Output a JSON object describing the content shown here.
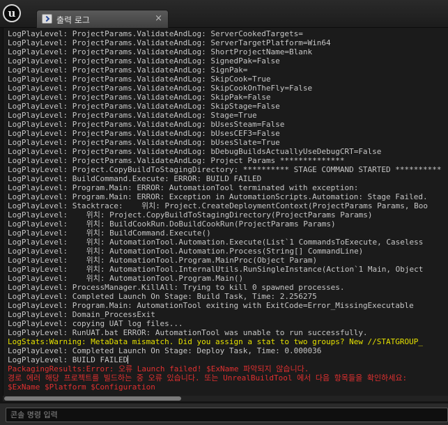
{
  "window": {
    "logo_glyph": "u",
    "tab": {
      "label": "출력 로그",
      "close": "×"
    }
  },
  "log": {
    "lines": [
      {
        "text": "LogPlayLevel: ProjectParams.ValidateAndLog: ServerCookedTargets=",
        "level": "info"
      },
      {
        "text": "LogPlayLevel: ProjectParams.ValidateAndLog: ServerTargetPlatform=Win64",
        "level": "info"
      },
      {
        "text": "LogPlayLevel: ProjectParams.ValidateAndLog: ShortProjectName=Blank",
        "level": "info"
      },
      {
        "text": "LogPlayLevel: ProjectParams.ValidateAndLog: SignedPak=False",
        "level": "info"
      },
      {
        "text": "LogPlayLevel: ProjectParams.ValidateAndLog: SignPak=",
        "level": "info"
      },
      {
        "text": "LogPlayLevel: ProjectParams.ValidateAndLog: SkipCook=True",
        "level": "info"
      },
      {
        "text": "LogPlayLevel: ProjectParams.ValidateAndLog: SkipCookOnTheFly=False",
        "level": "info"
      },
      {
        "text": "LogPlayLevel: ProjectParams.ValidateAndLog: SkipPak=False",
        "level": "info"
      },
      {
        "text": "LogPlayLevel: ProjectParams.ValidateAndLog: SkipStage=False",
        "level": "info"
      },
      {
        "text": "LogPlayLevel: ProjectParams.ValidateAndLog: Stage=True",
        "level": "info"
      },
      {
        "text": "LogPlayLevel: ProjectParams.ValidateAndLog: bUsesSteam=False",
        "level": "info"
      },
      {
        "text": "LogPlayLevel: ProjectParams.ValidateAndLog: bUsesCEF3=False",
        "level": "info"
      },
      {
        "text": "LogPlayLevel: ProjectParams.ValidateAndLog: bUsesSlate=True",
        "level": "info"
      },
      {
        "text": "LogPlayLevel: ProjectParams.ValidateAndLog: bDebugBuildsActuallyUseDebugCRT=False",
        "level": "info"
      },
      {
        "text": "LogPlayLevel: ProjectParams.ValidateAndLog: Project Params **************",
        "level": "info"
      },
      {
        "text": "LogPlayLevel: Project.CopyBuildToStagingDirectory: ********** STAGE COMMAND STARTED **********",
        "level": "info"
      },
      {
        "text": "LogPlayLevel: BuildCommand.Execute: ERROR: BUILD FAILED",
        "level": "info"
      },
      {
        "text": "LogPlayLevel: Program.Main: ERROR: AutomationTool terminated with exception:",
        "level": "info"
      },
      {
        "text": "LogPlayLevel: Program.Main: ERROR: Exception in AutomationScripts.Automation: Stage Failed.",
        "level": "info"
      },
      {
        "text": "LogPlayLevel: Stacktrace:    위치: Project.CreateDeploymentContext(ProjectParams Params, Boo",
        "level": "info"
      },
      {
        "text": "LogPlayLevel:    위치: Project.CopyBuildToStagingDirectory(ProjectParams Params)",
        "level": "info"
      },
      {
        "text": "LogPlayLevel:    위치: BuildCookRun.DoBuildCookRun(ProjectParams Params)",
        "level": "info"
      },
      {
        "text": "LogPlayLevel:    위치: BuildCommand.Execute()",
        "level": "info"
      },
      {
        "text": "LogPlayLevel:    위치: AutomationTool.Automation.Execute(List`1 CommandsToExecute, Caseless",
        "level": "info"
      },
      {
        "text": "LogPlayLevel:    위치: AutomationTool.Automation.Process(String[] CommandLine)",
        "level": "info"
      },
      {
        "text": "LogPlayLevel:    위치: AutomationTool.Program.MainProc(Object Param)",
        "level": "info"
      },
      {
        "text": "LogPlayLevel:    위치: AutomationTool.InternalUtils.RunSingleInstance(Action`1 Main, Object",
        "level": "info"
      },
      {
        "text": "LogPlayLevel:    위치: AutomationTool.Program.Main()",
        "level": "info"
      },
      {
        "text": "LogPlayLevel: ProcessManager.KillAll: Trying to kill 0 spawned processes.",
        "level": "info"
      },
      {
        "text": "LogPlayLevel: Completed Launch On Stage: Build Task, Time: 2.256275",
        "level": "info"
      },
      {
        "text": "LogPlayLevel: Program.Main: AutomationTool exiting with ExitCode=Error_MissingExecutable",
        "level": "info"
      },
      {
        "text": "LogPlayLevel: Domain_ProcessExit",
        "level": "info"
      },
      {
        "text": "LogPlayLevel: copying UAT log files...",
        "level": "info"
      },
      {
        "text": "LogPlayLevel: RunUAT.bat ERROR: AutomationTool was unable to run successfully.",
        "level": "info"
      },
      {
        "text": "LogStats:Warning: MetaData mismatch. Did you assign a stat to two groups? New //STATGROUP_",
        "level": "warn"
      },
      {
        "text": "LogPlayLevel: Completed Launch On Stage: Deploy Task, Time: 0.000036",
        "level": "info"
      },
      {
        "text": "LogPlayLevel: BUILD FAILED",
        "level": "info",
        "caret": true
      },
      {
        "text": "PackagingResults:Error: 오류 Launch failed! $ExName 파악되지 않습니다.",
        "level": "err"
      },
      {
        "text": "경로 에러 해당 프로젝트를 빌드하는 중 오류 있습니다. 또는 UnrealBuildTool 에서 다음 항목들을 확인하세요:",
        "level": "err"
      },
      {
        "text": "$ExName $Platform $Configuration",
        "level": "err"
      }
    ]
  },
  "console": {
    "placeholder": "콘솔 명령 입력"
  }
}
